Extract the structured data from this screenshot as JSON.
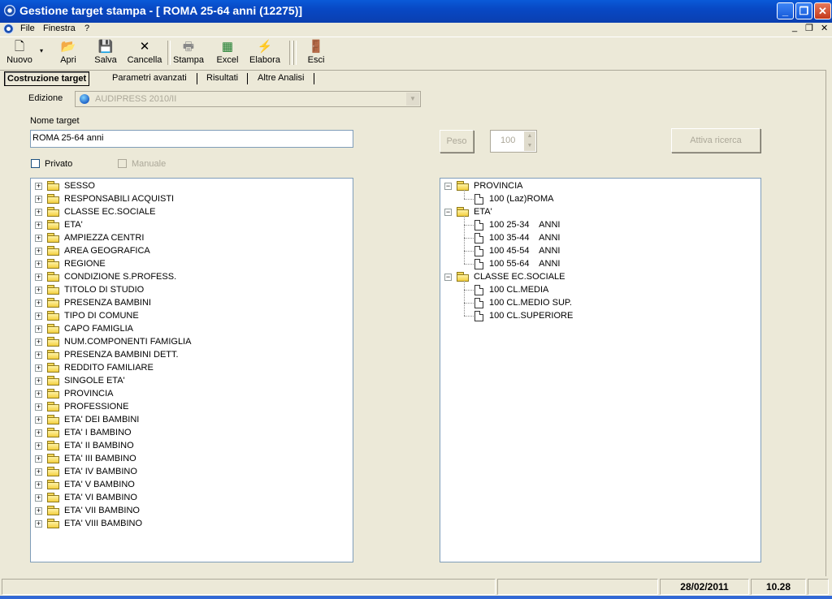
{
  "window": {
    "title": "Gestione target stampa - [ ROMA 25-64 anni (12275)]"
  },
  "menu": {
    "items": [
      "File",
      "Finestra",
      "?"
    ]
  },
  "toolbar": {
    "buttons": [
      {
        "label": "Nuovo",
        "icon": "new-document-icon"
      },
      {
        "label": "Apri",
        "icon": "open-folder-icon"
      },
      {
        "label": "Salva",
        "icon": "floppy-disk-icon"
      },
      {
        "label": "Cancella",
        "icon": "delete-x-icon"
      },
      {
        "label": "Stampa",
        "icon": "printer-icon"
      },
      {
        "label": "Excel",
        "icon": "excel-icon"
      },
      {
        "label": "Elabora",
        "icon": "lightning-icon"
      },
      {
        "label": "Esci",
        "icon": "exit-door-icon"
      }
    ]
  },
  "tabs": [
    "Costruzione target",
    "Parametri avanzati",
    "Risultati",
    "Altre Analisi"
  ],
  "form": {
    "edizione_label": "Edizione",
    "edizione_value": "AUDIPRESS 2010/II",
    "nome_label": "Nome target",
    "nome_value": "ROMA 25-64 anni",
    "privato_label": "Privato",
    "manuale_label": "Manuale",
    "peso_label": "Peso",
    "spin_value": "100",
    "attiva_label": "Attiva ricerca"
  },
  "left_tree": [
    "SESSO",
    "RESPONSABILI ACQUISTI",
    "CLASSE EC.SOCIALE",
    "ETA'",
    "AMPIEZZA CENTRI",
    "AREA GEOGRAFICA",
    "REGIONE",
    "CONDIZIONE S.PROFESS.",
    "TITOLO DI STUDIO",
    "PRESENZA BAMBINI",
    "TIPO DI COMUNE",
    "CAPO FAMIGLIA",
    "NUM.COMPONENTI FAMIGLIA",
    "PRESENZA BAMBINI DETT.",
    "REDDITO FAMILIARE",
    "SINGOLE ETA'",
    "PROVINCIA",
    "PROFESSIONE",
    "ETA' DEI BAMBINI",
    "ETA' I BAMBINO",
    "ETA' II BAMBINO",
    "ETA' III BAMBINO",
    "ETA' IV BAMBINO",
    "ETA' V BAMBINO",
    "ETA' VI BAMBINO",
    "ETA' VII BAMBINO",
    "ETA' VIII BAMBINO"
  ],
  "right_tree": [
    {
      "group": "PROVINCIA",
      "items": [
        "100 (Laz)ROMA"
      ]
    },
    {
      "group": "ETA'",
      "items": [
        "100 25-34    ANNI",
        "100 35-44    ANNI",
        "100 45-54    ANNI",
        "100 55-64    ANNI"
      ]
    },
    {
      "group": "CLASSE EC.SOCIALE",
      "items": [
        "100 CL.MEDIA",
        "100 CL.MEDIO SUP.",
        "100 CL.SUPERIORE"
      ]
    }
  ],
  "status": {
    "date": "28/02/2011",
    "time": "10.28"
  }
}
